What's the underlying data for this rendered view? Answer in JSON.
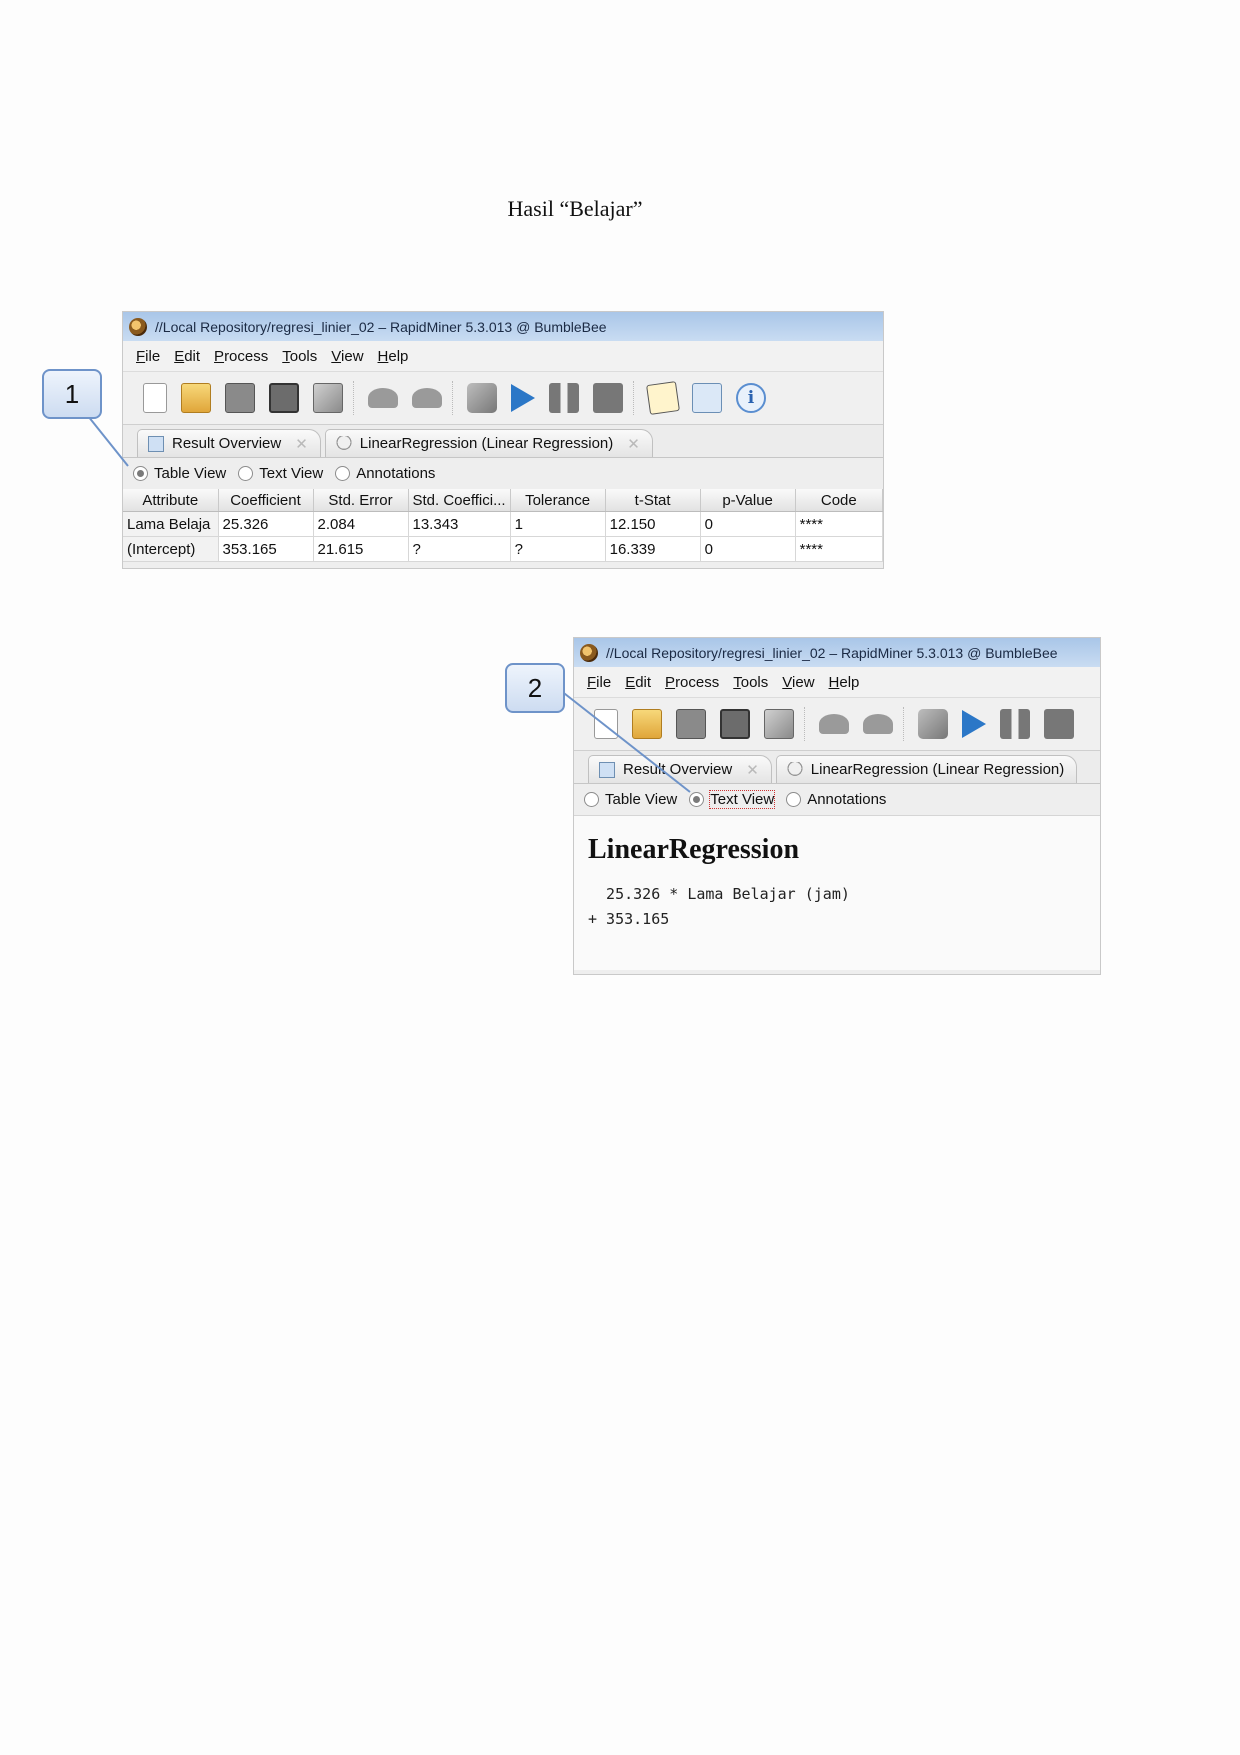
{
  "page": {
    "title": "Hasil “Belajar”"
  },
  "screenshot1": {
    "window_title": "//Local Repository/regresi_linier_02 – RapidMiner 5.3.013 @ BumbleBee",
    "menu": [
      "File",
      "Edit",
      "Process",
      "Tools",
      "View",
      "Help"
    ],
    "tabs": [
      {
        "label": "Result Overview"
      },
      {
        "label": "LinearRegression (Linear Regression)"
      }
    ],
    "views": {
      "table": "Table View",
      "text": "Text View",
      "annotations": "Annotations",
      "selected": "Table View"
    },
    "table": {
      "headers": [
        "Attribute",
        "Coefficient",
        "Std. Error",
        "Std. Coeffici...",
        "Tolerance",
        "t-Stat",
        "p-Value",
        "Code"
      ],
      "rows": [
        [
          "Lama Belaja",
          "25.326",
          "2.084",
          "13.343",
          "1",
          "12.150",
          "0",
          "****"
        ],
        [
          "(Intercept)",
          "353.165",
          "21.615",
          "?",
          "?",
          "16.339",
          "0",
          "****"
        ]
      ]
    },
    "callout": "1"
  },
  "screenshot2": {
    "window_title": "//Local Repository/regresi_linier_02 – RapidMiner 5.3.013 @ BumbleBee",
    "menu": [
      "File",
      "Edit",
      "Process",
      "Tools",
      "View",
      "Help"
    ],
    "tabs": [
      {
        "label": "Result Overview"
      },
      {
        "label": "LinearRegression (Linear Regression)"
      }
    ],
    "views": {
      "table": "Table View",
      "text": "Text View",
      "annotations": "Annotations",
      "selected": "Text View"
    },
    "text_view": {
      "heading": "LinearRegression",
      "line1": "  25.326 * Lama Belajar (jam)",
      "line2": "+ 353.165"
    },
    "callout": "2"
  },
  "colors": {
    "titlebar": "#b7d0ee",
    "callout_border": "#6e93c9",
    "play_icon": "#2b77c7"
  },
  "icons": [
    "app-icon",
    "new-icon",
    "open-icon",
    "save-icon",
    "save-as-icon",
    "print-icon",
    "undo-icon",
    "redo-icon",
    "operator-icon",
    "run-icon",
    "pause-icon",
    "stop-icon",
    "edit-icon",
    "result-perspective-icon",
    "info-icon"
  ]
}
